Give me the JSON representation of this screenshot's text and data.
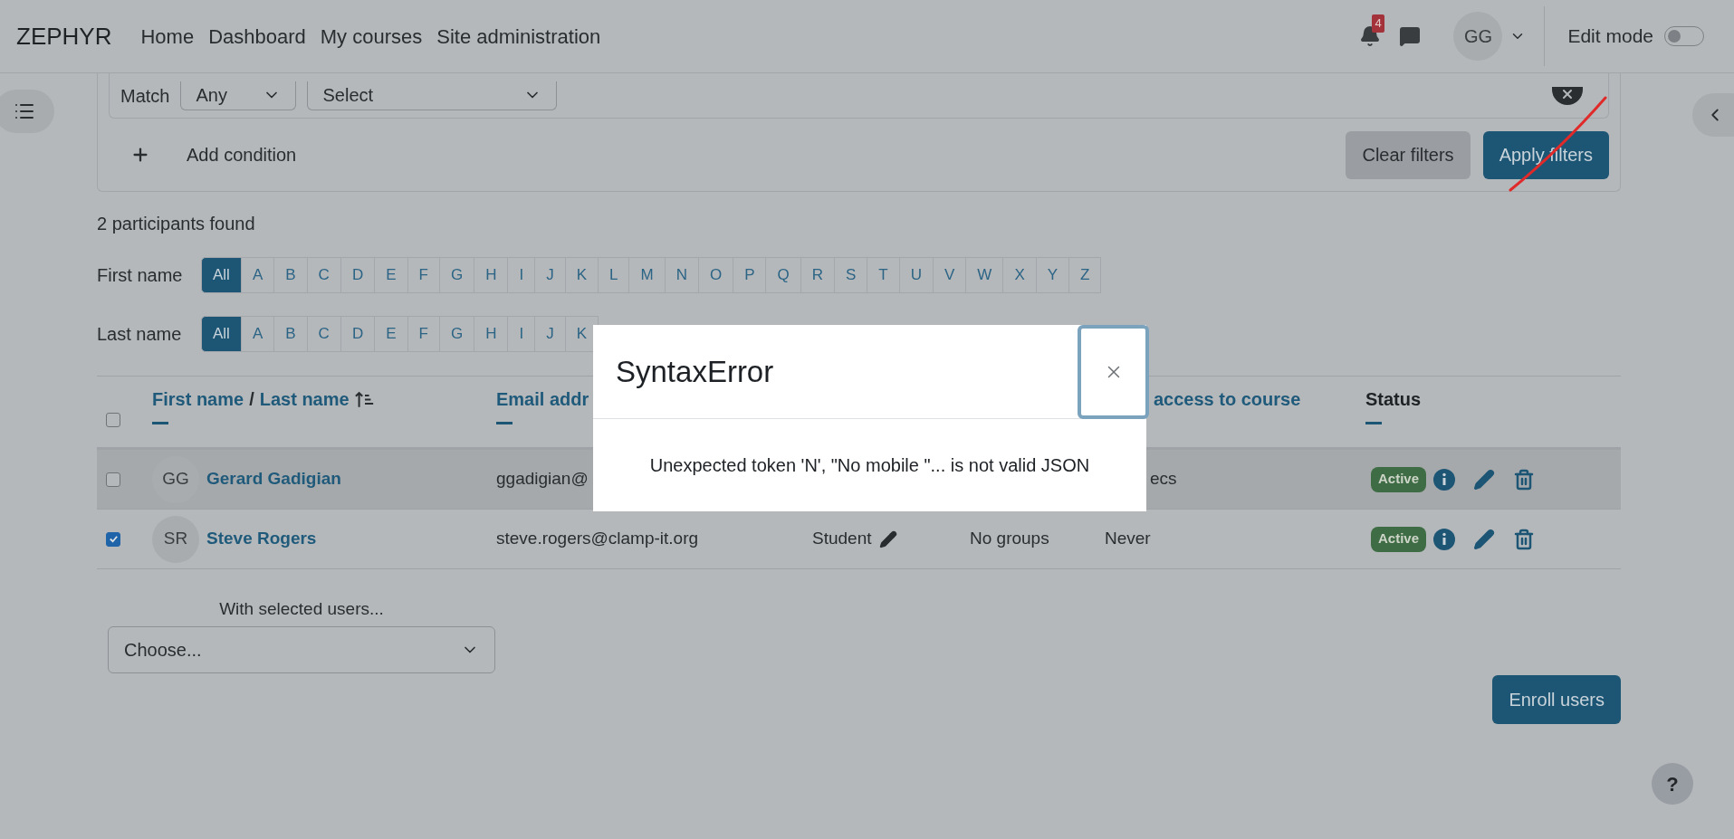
{
  "nav": {
    "brand": "ZEPHYR",
    "links": [
      "Home",
      "Dashboard",
      "My courses",
      "Site administration"
    ],
    "notification_count": "4",
    "avatar": "GG",
    "edit_mode": {
      "label": "Edit mode",
      "on": false
    }
  },
  "filter": {
    "match_label": "Match",
    "match_value": "Any",
    "condition_value": "Select",
    "add_condition": "Add condition",
    "buttons": [
      {
        "label": "Clear filters",
        "kind": "secondary"
      },
      {
        "label": "Apply filters",
        "kind": "primary"
      }
    ]
  },
  "participants_found": "2 participants found",
  "initials_bars": [
    {
      "label": "First name",
      "letters": [
        {
          "text": "All",
          "selected": true
        },
        {
          "text": "A",
          "selected": false
        },
        {
          "text": "B",
          "selected": false
        },
        {
          "text": "C",
          "selected": false
        },
        {
          "text": "D",
          "selected": false
        },
        {
          "text": "E",
          "selected": false
        },
        {
          "text": "F",
          "selected": false
        },
        {
          "text": "G",
          "selected": false
        },
        {
          "text": "H",
          "selected": false
        },
        {
          "text": "I",
          "selected": false
        },
        {
          "text": "J",
          "selected": false
        },
        {
          "text": "K",
          "selected": false
        },
        {
          "text": "L",
          "selected": false
        },
        {
          "text": "M",
          "selected": false
        },
        {
          "text": "N",
          "selected": false
        },
        {
          "text": "O",
          "selected": false
        },
        {
          "text": "P",
          "selected": false
        },
        {
          "text": "Q",
          "selected": false
        },
        {
          "text": "R",
          "selected": false
        },
        {
          "text": "S",
          "selected": false
        },
        {
          "text": "T",
          "selected": false
        },
        {
          "text": "U",
          "selected": false
        },
        {
          "text": "V",
          "selected": false
        },
        {
          "text": "W",
          "selected": false
        },
        {
          "text": "X",
          "selected": false
        },
        {
          "text": "Y",
          "selected": false
        },
        {
          "text": "Z",
          "selected": false
        }
      ]
    },
    {
      "label": "Last name",
      "letters": [
        {
          "text": "All",
          "selected": true
        },
        {
          "text": "A",
          "selected": false
        },
        {
          "text": "B",
          "selected": false
        },
        {
          "text": "C",
          "selected": false
        },
        {
          "text": "D",
          "selected": false
        },
        {
          "text": "E",
          "selected": false
        },
        {
          "text": "F",
          "selected": false
        },
        {
          "text": "G",
          "selected": false
        },
        {
          "text": "H",
          "selected": false
        },
        {
          "text": "I",
          "selected": false
        },
        {
          "text": "J",
          "selected": false
        },
        {
          "text": "K",
          "selected": false
        }
      ]
    }
  ],
  "table": {
    "select_all": {
      "checked": false
    },
    "columns": {
      "first_name": "First name",
      "separator": "/",
      "last_name": "Last name",
      "email": "Email addr",
      "last_access": "access to course",
      "status": "Status"
    },
    "rows": [
      {
        "checked": false,
        "highlighted": true,
        "initials": "GG",
        "name": "Gerard Gadigian",
        "email": "ggadigian@",
        "last_access": "ecs",
        "status": "Active"
      },
      {
        "checked": true,
        "highlighted": false,
        "initials": "SR",
        "name": "Steve Rogers",
        "email": "steve.rogers@clamp-it.org",
        "role": "Student",
        "groups": "No groups",
        "last_access": "Never",
        "status": "Active"
      }
    ]
  },
  "bulk": {
    "label": "With selected users...",
    "value": "Choose..."
  },
  "enroll_button": "Enroll users",
  "help_button": "?",
  "modal": {
    "title": "SyntaxError",
    "message": "Unexpected token 'N', \"No mobile \"... is not valid JSON"
  }
}
